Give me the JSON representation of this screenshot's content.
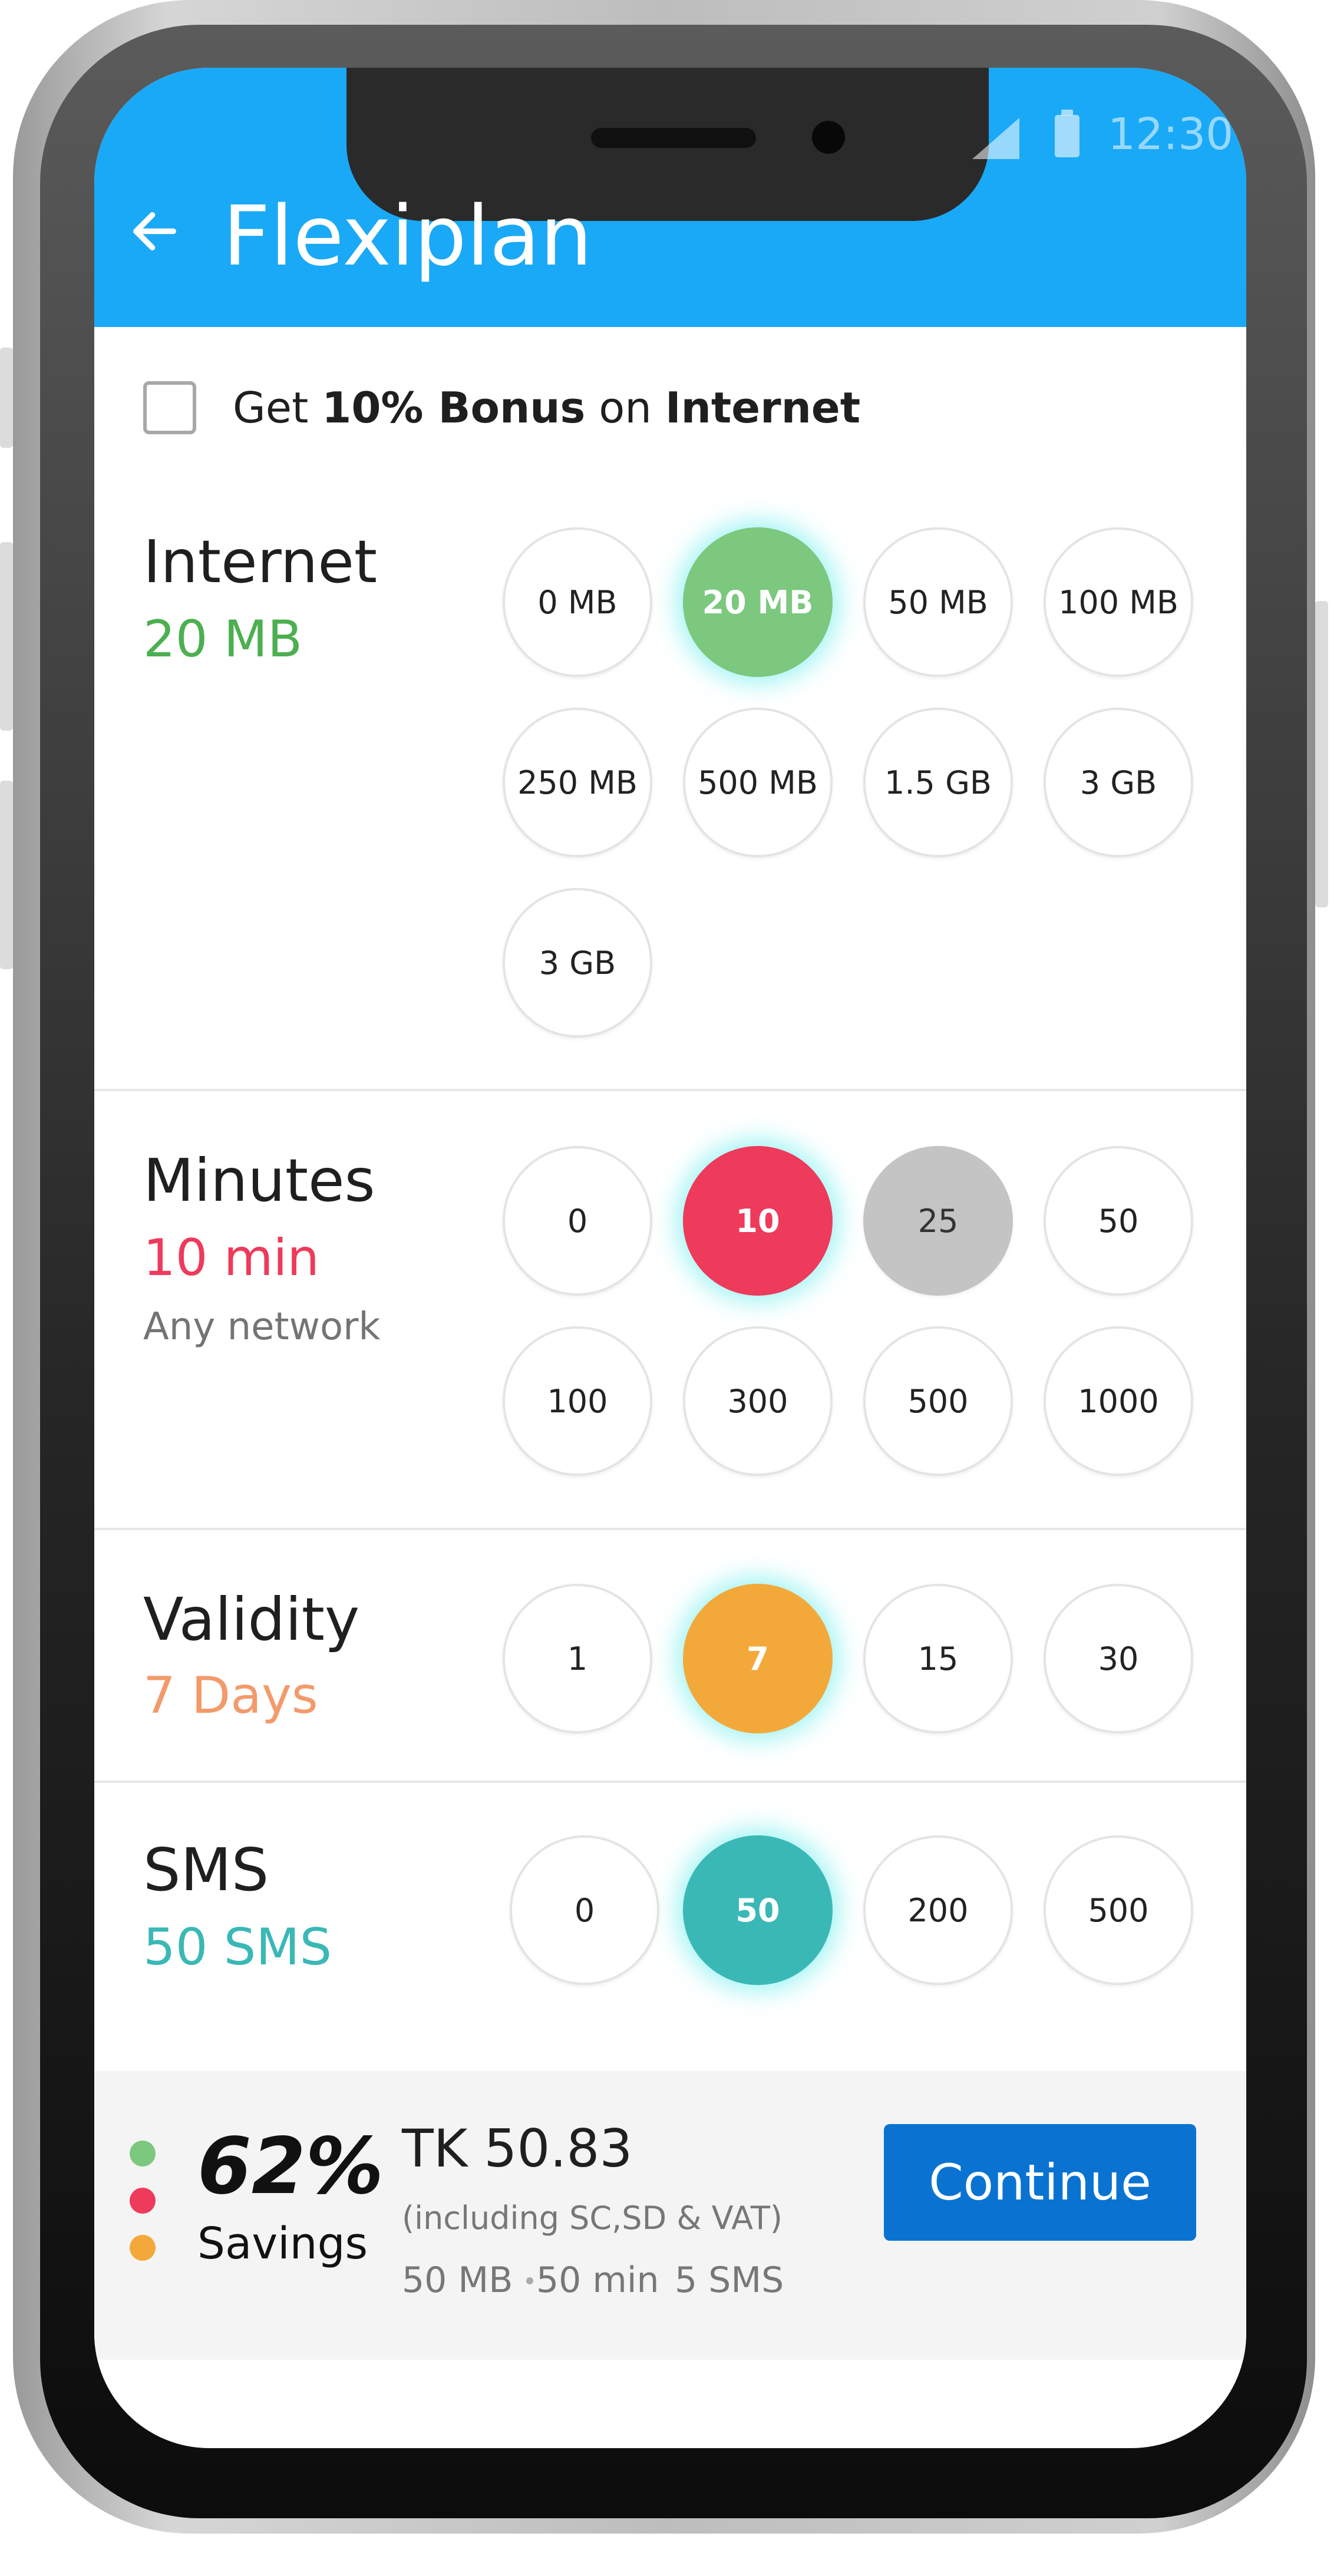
{
  "status_bar": {
    "time": "12:30"
  },
  "app_bar": {
    "title": "Flexiplan",
    "back_icon": "arrow-left-icon"
  },
  "bonus": {
    "checked": false,
    "prefix": "Get ",
    "bold1": "10% Bonus",
    "middle": " on ",
    "bold2": "Internet"
  },
  "internet": {
    "title": "Internet",
    "value": "20 MB",
    "color": "#4caf50",
    "options": [
      "0 MB",
      "20 MB",
      "50 MB",
      "100 MB",
      "250 MB",
      "500 MB",
      "1.5 GB",
      "3 GB",
      "3 GB"
    ],
    "selected": "20 MB"
  },
  "minutes": {
    "title": "Minutes",
    "value": "10 min",
    "subtitle": "Any network",
    "color": "#ee3a5b",
    "options": [
      "0",
      "10",
      "25",
      "50",
      "100",
      "300",
      "500",
      "1000"
    ],
    "selected": "10",
    "highlighted_grey": "25"
  },
  "validity": {
    "title": "Validity",
    "value": "7 Days",
    "color": "#f39a6b",
    "options": [
      "1",
      "7",
      "15",
      "30"
    ],
    "selected": "7"
  },
  "sms": {
    "title": "SMS",
    "value": "50 SMS",
    "color": "#3ab8b6",
    "options": [
      "0",
      "50",
      "200",
      "500"
    ],
    "selected": "50"
  },
  "summary": {
    "dot_colors": [
      "#7bc87e",
      "#ee3a5b",
      "#f3a93a"
    ],
    "percent": "62%",
    "savings_label": "Savings",
    "price": "TK 50.83",
    "price_note": "(including SC,SD & VAT)",
    "pack_data": "50 MB",
    "pack_minutes": "50 min",
    "pack_sms": "5 SMS",
    "continue_label": "Continue"
  },
  "colors": {
    "app_bar": "#1aa9f6",
    "continue_button": "#0a73d2"
  }
}
